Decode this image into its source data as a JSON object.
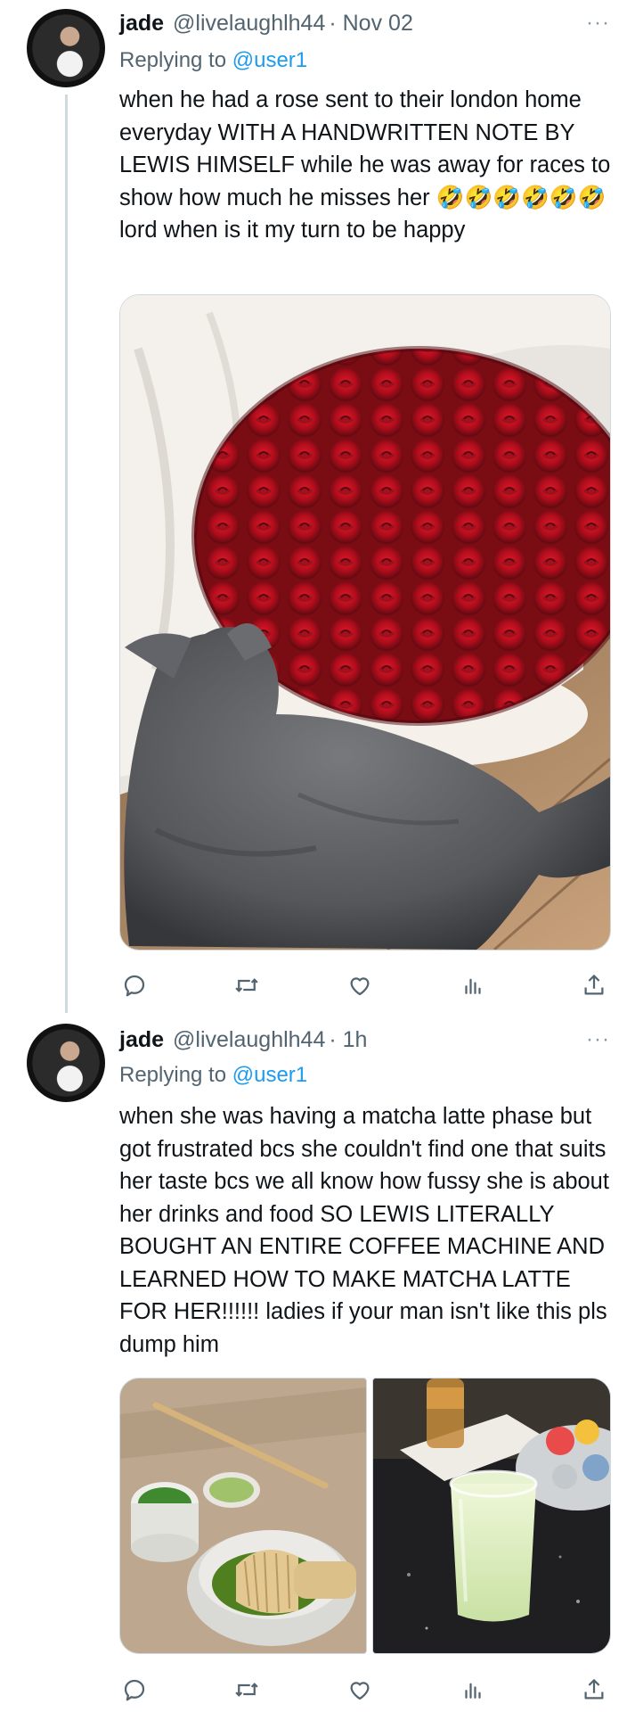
{
  "tweets": [
    {
      "name": "jade",
      "handle": "@livelaughlh44",
      "time": "· Nov 02",
      "replying_prefix": "Replying to",
      "replying_to": "@user1",
      "text": "when he had a rose sent to their london home everyday WITH A HANDWRITTEN NOTE BY LEWIS HIMSELF while he was away for races to show how much he misses her 🤣🤣🤣🤣🤣🤣 lord when is it my turn to be happy",
      "more": "···"
    },
    {
      "name": "jade",
      "handle": "@livelaughlh44",
      "time": "· 1h",
      "replying_prefix": "Replying to",
      "replying_to": "@user1",
      "text": "when she was having a matcha latte phase but got frustrated bcs she couldn't find one that suits her taste bcs we all know how fussy she is about her drinks and food SO LEWIS LITERALLY BOUGHT AN ENTIRE COFFEE MACHINE AND LEARNED HOW TO MAKE MATCHA LATTE FOR HER!!!!!! ladies if your man isn't like this pls dump him",
      "more": "···"
    }
  ],
  "icons": [
    "reply-icon",
    "retweet-icon",
    "like-icon",
    "views-icon",
    "share-icon"
  ],
  "colors": {
    "accent": "#1d9bf0",
    "secondary_text": "#536471",
    "icon": "#536471"
  }
}
